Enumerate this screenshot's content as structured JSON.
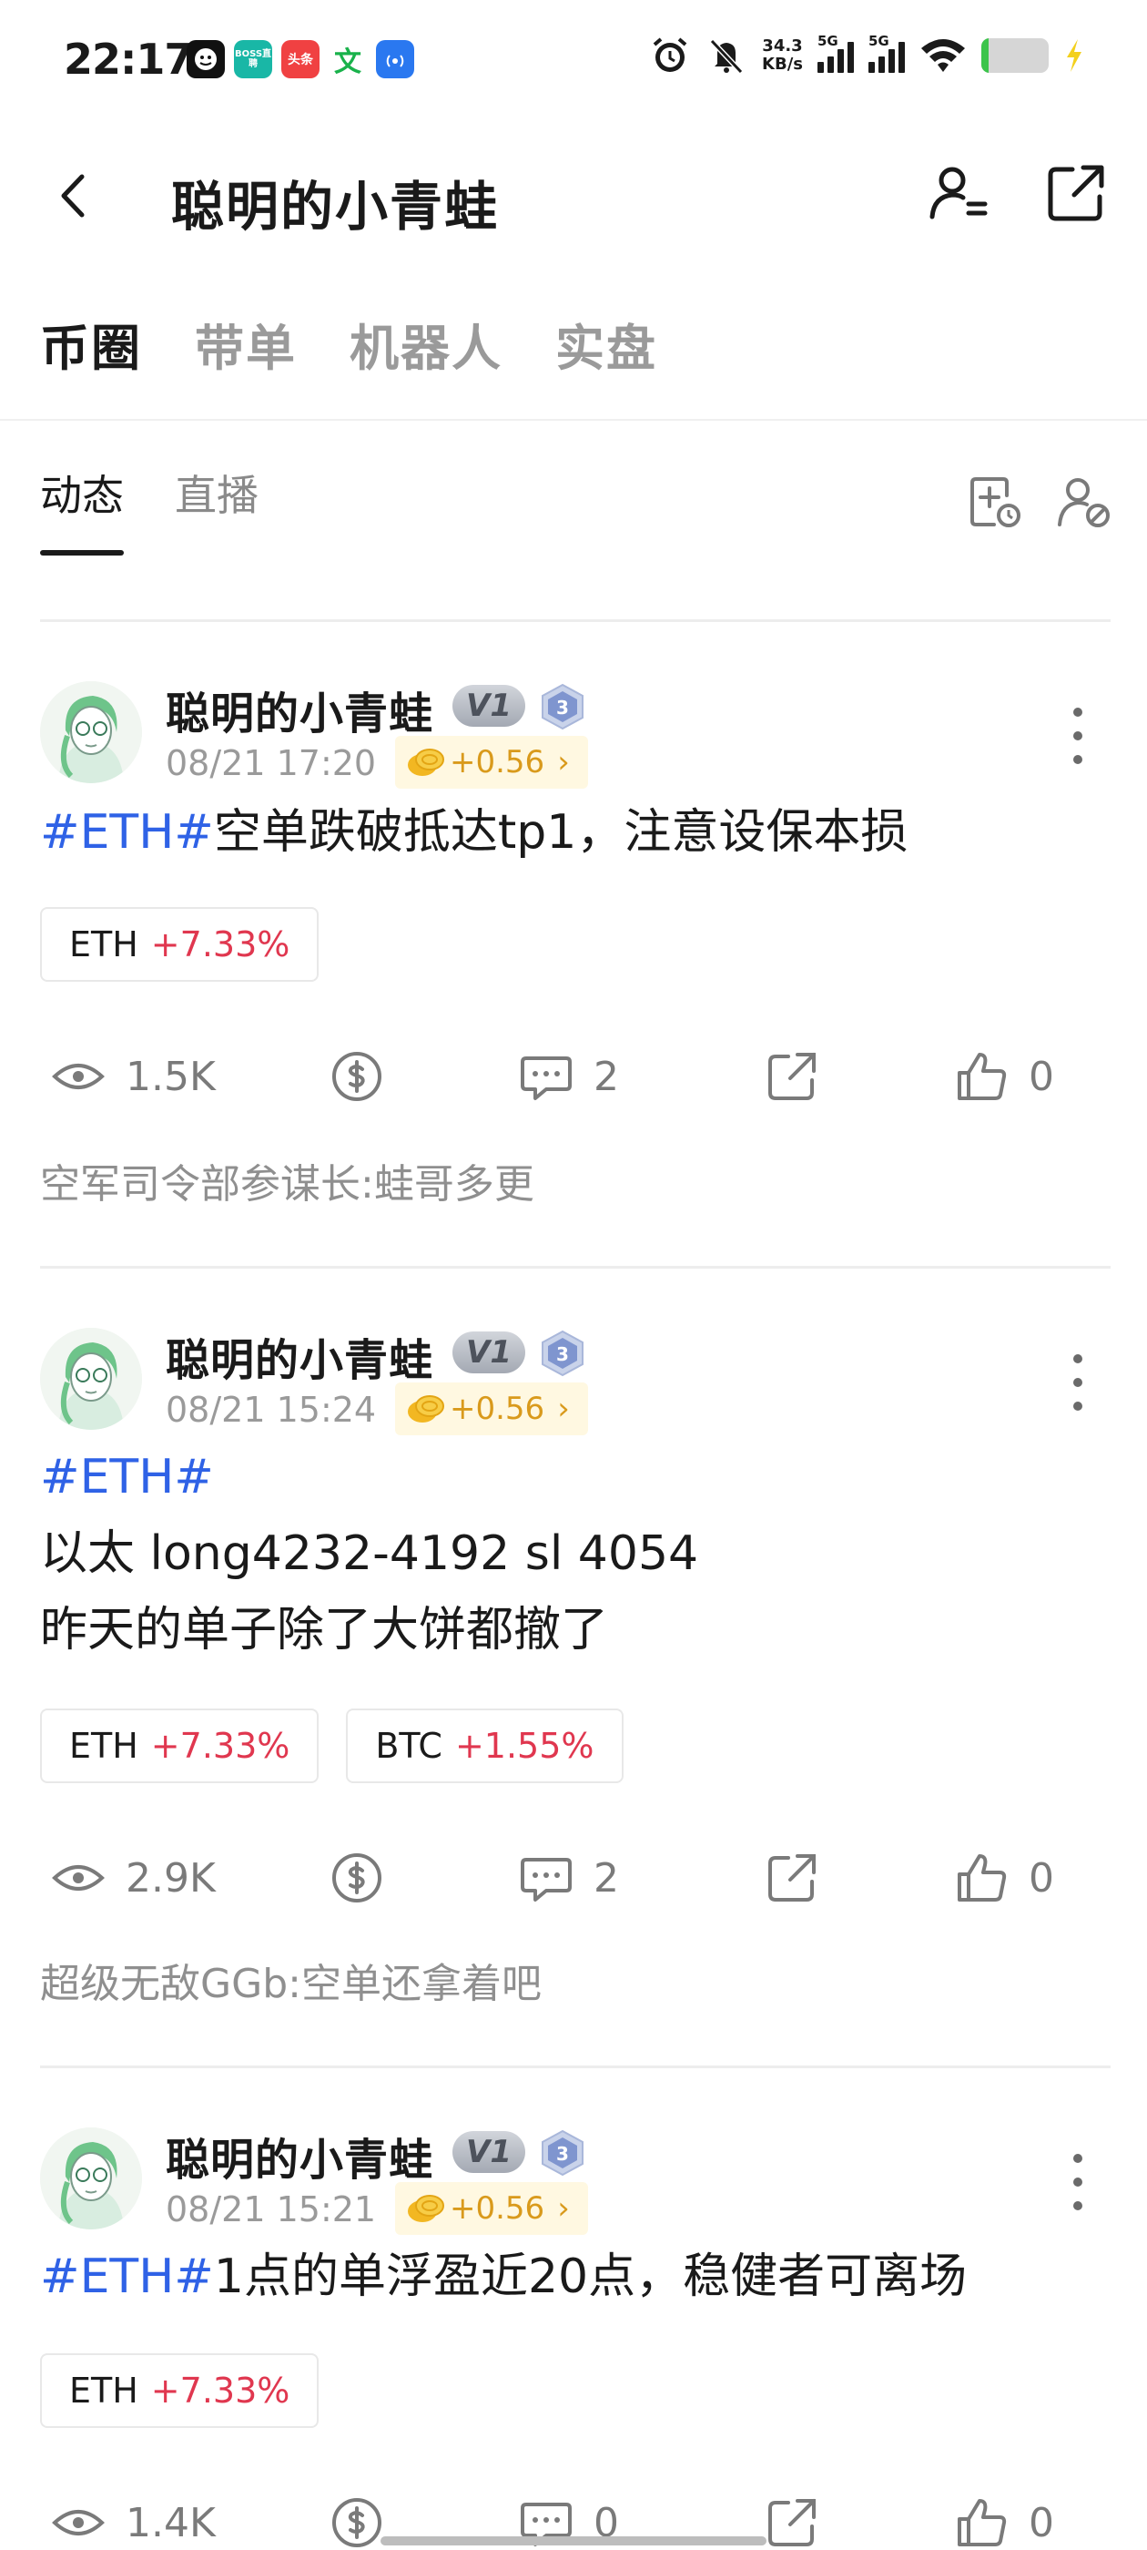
{
  "status_bar": {
    "time": "22:17",
    "app_icons": [
      "soul-icon",
      "boss-icon",
      "toutiao-icon",
      "wen-icon",
      "signal-app-icon"
    ],
    "boss_label": "BOSS直聘",
    "toutiao_label": "头条",
    "wen_label": "文",
    "speed_value": "34.3",
    "speed_unit": "KB/s",
    "signal_1": "5G",
    "signal_2": "5G"
  },
  "header": {
    "title": "聪明的小青蛙"
  },
  "main_tabs": [
    {
      "label": "币圈",
      "active": true
    },
    {
      "label": "带单",
      "active": false
    },
    {
      "label": "机器人",
      "active": false
    },
    {
      "label": "实盘",
      "active": false
    }
  ],
  "sub_tabs": [
    {
      "label": "动态",
      "active": true
    },
    {
      "label": "直播",
      "active": false
    }
  ],
  "posts": [
    {
      "author": "聪明的小青蛙",
      "vip": "V1",
      "level": "3",
      "time": "08/21 17:20",
      "reward": "+0.56",
      "hashtag": "#ETH#",
      "text": "空单跌破抵达tp1，注意设保本损",
      "tags": [
        {
          "symbol": "ETH",
          "change": "+7.33%"
        }
      ],
      "views": "1.5K",
      "comments": "2",
      "likes": "0",
      "comment_preview": "空军司令部参谋长:蛙哥多更"
    },
    {
      "author": "聪明的小青蛙",
      "vip": "V1",
      "level": "3",
      "time": "08/21 15:24",
      "reward": "+0.56",
      "hashtag": "#ETH#",
      "text": "以太 long4232-4192 sl 4054\n昨天的单子除了大饼都撤了",
      "tags": [
        {
          "symbol": "ETH",
          "change": "+7.33%"
        },
        {
          "symbol": "BTC",
          "change": "+1.55%"
        }
      ],
      "views": "2.9K",
      "comments": "2",
      "likes": "0",
      "comment_preview": "超级无敌GGb:空单还拿着吧"
    },
    {
      "author": "聪明的小青蛙",
      "vip": "V1",
      "level": "3",
      "time": "08/21 15:21",
      "reward": "+0.56",
      "hashtag": "#ETH#",
      "text": "1点的单浮盈近20点，稳健者可离场",
      "tags": [
        {
          "symbol": "ETH",
          "change": "+7.33%"
        }
      ],
      "views": "1.4K",
      "comments": "0",
      "likes": "0"
    }
  ],
  "colors": {
    "hashtag": "#2f62e6",
    "up": "#e0374f",
    "reward": "#d99a1c",
    "muted": "#9a9a9a"
  }
}
